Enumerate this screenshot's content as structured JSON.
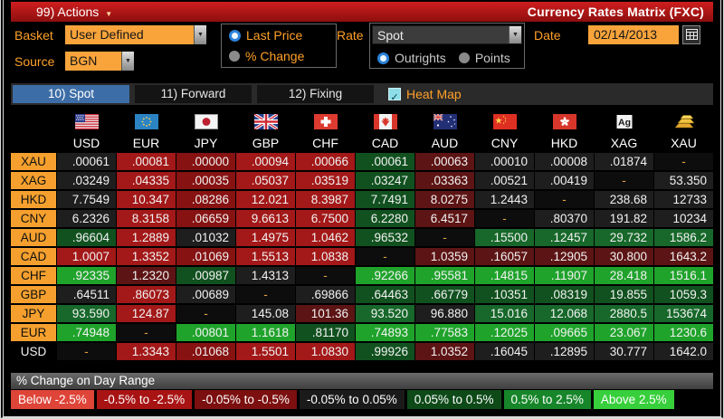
{
  "titlebar": {
    "actions_label": "99) Actions",
    "title": "Currency Rates Matrix (FXC)"
  },
  "controls": {
    "basket_label": "Basket",
    "basket_value": "User Defined",
    "source_label": "Source",
    "source_value": "BGN",
    "price_mode": {
      "options": [
        "Last Price",
        "% Change"
      ],
      "selected": "Last Price"
    },
    "rate_label": "Rate",
    "rate_value": "Spot",
    "rate_mode": {
      "options": [
        "Outrights",
        "Points"
      ],
      "selected": "Outrights"
    },
    "date_label": "Date",
    "date_value": "02/14/2013"
  },
  "tabs": [
    {
      "label": "10) Spot",
      "active": true
    },
    {
      "label": "11) Forward",
      "active": false
    },
    {
      "label": "12) Fixing",
      "active": false
    }
  ],
  "heat_map": {
    "label": "Heat Map",
    "checked": true
  },
  "heat_colors": {
    "k": "#1e1e1e",
    "r2": "#a31818",
    "r3": "#871212",
    "r4": "#5d1414",
    "g2": "#1fa32b",
    "g3": "#11511f",
    "g4": "#17682a",
    "d": "#0d0d0d"
  },
  "matrix": {
    "columns": [
      {
        "code": "USD",
        "flag": "us-flag-icon"
      },
      {
        "code": "EUR",
        "flag": "eu-flag-icon"
      },
      {
        "code": "JPY",
        "flag": "japan-flag-icon"
      },
      {
        "code": "GBP",
        "flag": "uk-flag-icon"
      },
      {
        "code": "CHF",
        "flag": "switzerland-flag-icon"
      },
      {
        "code": "CAD",
        "flag": "canada-flag-icon"
      },
      {
        "code": "AUD",
        "flag": "australia-flag-icon"
      },
      {
        "code": "CNY",
        "flag": "china-flag-icon"
      },
      {
        "code": "HKD",
        "flag": "hongkong-flag-icon"
      },
      {
        "code": "XAG",
        "flag": "silver-icon"
      },
      {
        "code": "XAU",
        "flag": "gold-icon"
      }
    ],
    "rows": [
      {
        "label": "XAU",
        "cells": [
          {
            "v": ".00061",
            "c": "k"
          },
          {
            "v": ".00081",
            "c": "r2"
          },
          {
            "v": ".00000",
            "c": "r3"
          },
          {
            "v": ".00094",
            "c": "r2"
          },
          {
            "v": ".00066",
            "c": "r2"
          },
          {
            "v": ".00061",
            "c": "g3"
          },
          {
            "v": ".00063",
            "c": "r4"
          },
          {
            "v": ".00010",
            "c": "k"
          },
          {
            "v": ".00008",
            "c": "k"
          },
          {
            "v": ".01874",
            "c": "k"
          },
          {
            "v": "-",
            "c": "d"
          }
        ]
      },
      {
        "label": "XAG",
        "cells": [
          {
            "v": ".03249",
            "c": "k"
          },
          {
            "v": ".04335",
            "c": "r2"
          },
          {
            "v": ".00035",
            "c": "r3"
          },
          {
            "v": ".05037",
            "c": "r2"
          },
          {
            "v": ".03519",
            "c": "r2"
          },
          {
            "v": ".03247",
            "c": "g3"
          },
          {
            "v": ".03363",
            "c": "r4"
          },
          {
            "v": ".00521",
            "c": "k"
          },
          {
            "v": ".00419",
            "c": "k"
          },
          {
            "v": "-",
            "c": "d"
          },
          {
            "v": "53.350",
            "c": "k"
          }
        ]
      },
      {
        "label": "HKD",
        "cells": [
          {
            "v": "7.7549",
            "c": "k"
          },
          {
            "v": "10.347",
            "c": "r2"
          },
          {
            "v": ".08286",
            "c": "r3"
          },
          {
            "v": "12.021",
            "c": "r2"
          },
          {
            "v": "8.3987",
            "c": "r2"
          },
          {
            "v": "7.7491",
            "c": "g3"
          },
          {
            "v": "8.0275",
            "c": "r4"
          },
          {
            "v": "1.2443",
            "c": "k"
          },
          {
            "v": "-",
            "c": "d"
          },
          {
            "v": "238.68",
            "c": "k"
          },
          {
            "v": "12733",
            "c": "k"
          }
        ]
      },
      {
        "label": "CNY",
        "cells": [
          {
            "v": "6.2326",
            "c": "k"
          },
          {
            "v": "8.3158",
            "c": "r2"
          },
          {
            "v": ".06659",
            "c": "r3"
          },
          {
            "v": "9.6613",
            "c": "r2"
          },
          {
            "v": "6.7500",
            "c": "r2"
          },
          {
            "v": "6.2280",
            "c": "g3"
          },
          {
            "v": "6.4517",
            "c": "r4"
          },
          {
            "v": "-",
            "c": "d"
          },
          {
            "v": ".80370",
            "c": "k"
          },
          {
            "v": "191.82",
            "c": "k"
          },
          {
            "v": "10234",
            "c": "k"
          }
        ]
      },
      {
        "label": "AUD",
        "cells": [
          {
            "v": ".96604",
            "c": "g3"
          },
          {
            "v": "1.2889",
            "c": "r2"
          },
          {
            "v": ".01032",
            "c": "k"
          },
          {
            "v": "1.4975",
            "c": "r2"
          },
          {
            "v": "1.0462",
            "c": "r2"
          },
          {
            "v": ".96532",
            "c": "g3"
          },
          {
            "v": "-",
            "c": "d"
          },
          {
            "v": ".15500",
            "c": "g4"
          },
          {
            "v": ".12457",
            "c": "g4"
          },
          {
            "v": "29.732",
            "c": "g4"
          },
          {
            "v": "1586.2",
            "c": "g4"
          }
        ]
      },
      {
        "label": "CAD",
        "cells": [
          {
            "v": "1.0007",
            "c": "r2"
          },
          {
            "v": "1.3352",
            "c": "r2"
          },
          {
            "v": ".01069",
            "c": "r3"
          },
          {
            "v": "1.5513",
            "c": "r2"
          },
          {
            "v": "1.0838",
            "c": "r2"
          },
          {
            "v": "-",
            "c": "d"
          },
          {
            "v": "1.0359",
            "c": "r4"
          },
          {
            "v": ".16057",
            "c": "r4"
          },
          {
            "v": ".12905",
            "c": "r4"
          },
          {
            "v": "30.800",
            "c": "r4"
          },
          {
            "v": "1643.2",
            "c": "r4"
          }
        ]
      },
      {
        "label": "CHF",
        "cells": [
          {
            "v": ".92335",
            "c": "g2"
          },
          {
            "v": "1.2320",
            "c": "r4"
          },
          {
            "v": ".00987",
            "c": "g3"
          },
          {
            "v": "1.4313",
            "c": "k"
          },
          {
            "v": "-",
            "c": "d"
          },
          {
            "v": ".92266",
            "c": "g2"
          },
          {
            "v": ".95581",
            "c": "g2"
          },
          {
            "v": ".14815",
            "c": "g2"
          },
          {
            "v": ".11907",
            "c": "g2"
          },
          {
            "v": "28.418",
            "c": "g2"
          },
          {
            "v": "1516.1",
            "c": "g2"
          }
        ]
      },
      {
        "label": "GBP",
        "cells": [
          {
            "v": ".64511",
            "c": "k"
          },
          {
            "v": ".86073",
            "c": "r2"
          },
          {
            "v": ".00689",
            "c": "k"
          },
          {
            "v": "-",
            "c": "d"
          },
          {
            "v": ".69866",
            "c": "k"
          },
          {
            "v": ".64463",
            "c": "g3"
          },
          {
            "v": ".66779",
            "c": "g3"
          },
          {
            "v": ".10351",
            "c": "g3"
          },
          {
            "v": ".08319",
            "c": "g3"
          },
          {
            "v": "19.855",
            "c": "g3"
          },
          {
            "v": "1059.3",
            "c": "g3"
          }
        ]
      },
      {
        "label": "JPY",
        "cells": [
          {
            "v": "93.590",
            "c": "g4"
          },
          {
            "v": "124.87",
            "c": "r2"
          },
          {
            "v": "-",
            "c": "d"
          },
          {
            "v": "145.08",
            "c": "k"
          },
          {
            "v": "101.36",
            "c": "r4"
          },
          {
            "v": "93.520",
            "c": "g4"
          },
          {
            "v": "96.880",
            "c": "k"
          },
          {
            "v": "15.016",
            "c": "g4"
          },
          {
            "v": "12.068",
            "c": "g4"
          },
          {
            "v": "2880.5",
            "c": "g4"
          },
          {
            "v": "153674",
            "c": "g4"
          }
        ]
      },
      {
        "label": "EUR",
        "cells": [
          {
            "v": ".74948",
            "c": "g2"
          },
          {
            "v": "-",
            "c": "d"
          },
          {
            "v": ".00801",
            "c": "g2"
          },
          {
            "v": "1.1618",
            "c": "g2"
          },
          {
            "v": ".81170",
            "c": "g3"
          },
          {
            "v": ".74893",
            "c": "g2"
          },
          {
            "v": ".77583",
            "c": "g2"
          },
          {
            "v": ".12025",
            "c": "g2"
          },
          {
            "v": ".09665",
            "c": "g2"
          },
          {
            "v": "23.067",
            "c": "g2"
          },
          {
            "v": "1230.6",
            "c": "g2"
          }
        ]
      },
      {
        "label": "USD",
        "plain": true,
        "cells": [
          {
            "v": "-",
            "c": "d"
          },
          {
            "v": "1.3343",
            "c": "r2"
          },
          {
            "v": ".01068",
            "c": "r3"
          },
          {
            "v": "1.5501",
            "c": "r2"
          },
          {
            "v": "1.0830",
            "c": "r2"
          },
          {
            "v": ".99926",
            "c": "g3"
          },
          {
            "v": "1.0352",
            "c": "r4"
          },
          {
            "v": ".16045",
            "c": "k"
          },
          {
            "v": ".12895",
            "c": "k"
          },
          {
            "v": "30.777",
            "c": "k"
          },
          {
            "v": "1642.0",
            "c": "k"
          }
        ]
      }
    ]
  },
  "legend": {
    "title": "% Change on Day Range",
    "items": [
      {
        "label": "Below -2.5%",
        "color": "#de4438"
      },
      {
        "label": "-0.5% to -2.5%",
        "color": "#a81414"
      },
      {
        "label": "-0.05% to -0.5%",
        "color": "#7c0f0f"
      },
      {
        "label": "-0.05% to 0.05%",
        "color": "#1a1a1a"
      },
      {
        "label": "0.05% to 0.5%",
        "color": "#0d4a18"
      },
      {
        "label": "0.5% to 2.5%",
        "color": "#17862a"
      },
      {
        "label": "Above 2.5%",
        "color": "#37cf3b"
      }
    ]
  }
}
